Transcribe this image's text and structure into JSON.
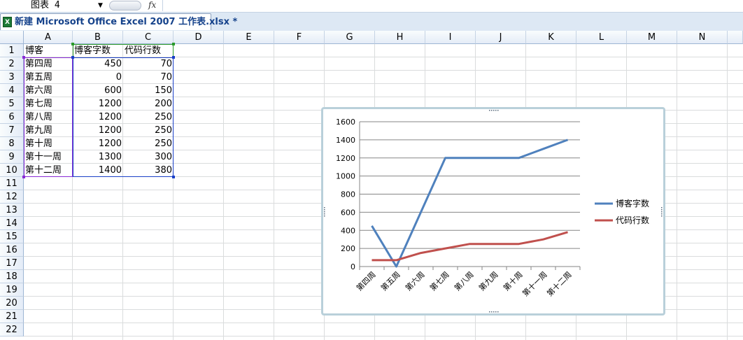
{
  "formula_bar": {
    "name_box": "图表 4",
    "fx_label": "fx"
  },
  "document_tab": {
    "icon": "excel-file-icon",
    "title": "新建 Microsoft Office Excel 2007 工作表.xlsx *"
  },
  "columns": [
    "A",
    "B",
    "C",
    "D",
    "E",
    "F",
    "G",
    "H",
    "I",
    "J",
    "K",
    "L",
    "M",
    "N"
  ],
  "rows": [
    "1",
    "2",
    "3",
    "4",
    "5",
    "6",
    "7",
    "8",
    "9",
    "10",
    "11",
    "12",
    "13",
    "14",
    "15",
    "16",
    "17",
    "18",
    "19",
    "20",
    "21",
    "22"
  ],
  "table": {
    "headers": [
      "博客",
      "博客字数",
      "代码行数"
    ],
    "rows": [
      [
        "第四周",
        "450",
        "70"
      ],
      [
        "第五周",
        "0",
        "70"
      ],
      [
        "第六周",
        "600",
        "150"
      ],
      [
        "第七周",
        "1200",
        "200"
      ],
      [
        "第八周",
        "1200",
        "250"
      ],
      [
        "第九周",
        "1200",
        "250"
      ],
      [
        "第十周",
        "1200",
        "250"
      ],
      [
        "第十一周",
        "1300",
        "300"
      ],
      [
        "第十二周",
        "1400",
        "380"
      ]
    ]
  },
  "colors": {
    "series1": "#4f81bd",
    "series2": "#c0504d",
    "gridline": "#868686"
  },
  "chart_data": {
    "type": "line",
    "categories": [
      "第四周",
      "第五周",
      "第六周",
      "第七周",
      "第八周",
      "第九周",
      "第十周",
      "第十一周",
      "第十二周"
    ],
    "series": [
      {
        "name": "博客字数",
        "values": [
          450,
          0,
          600,
          1200,
          1200,
          1200,
          1200,
          1300,
          1400
        ]
      },
      {
        "name": "代码行数",
        "values": [
          70,
          70,
          150,
          200,
          250,
          250,
          250,
          300,
          380
        ]
      }
    ],
    "ylim": [
      0,
      1600
    ],
    "yticks": [
      "0",
      "200",
      "400",
      "600",
      "800",
      "1000",
      "1200",
      "1400",
      "1600"
    ],
    "grid": true,
    "legend_position": "right"
  }
}
